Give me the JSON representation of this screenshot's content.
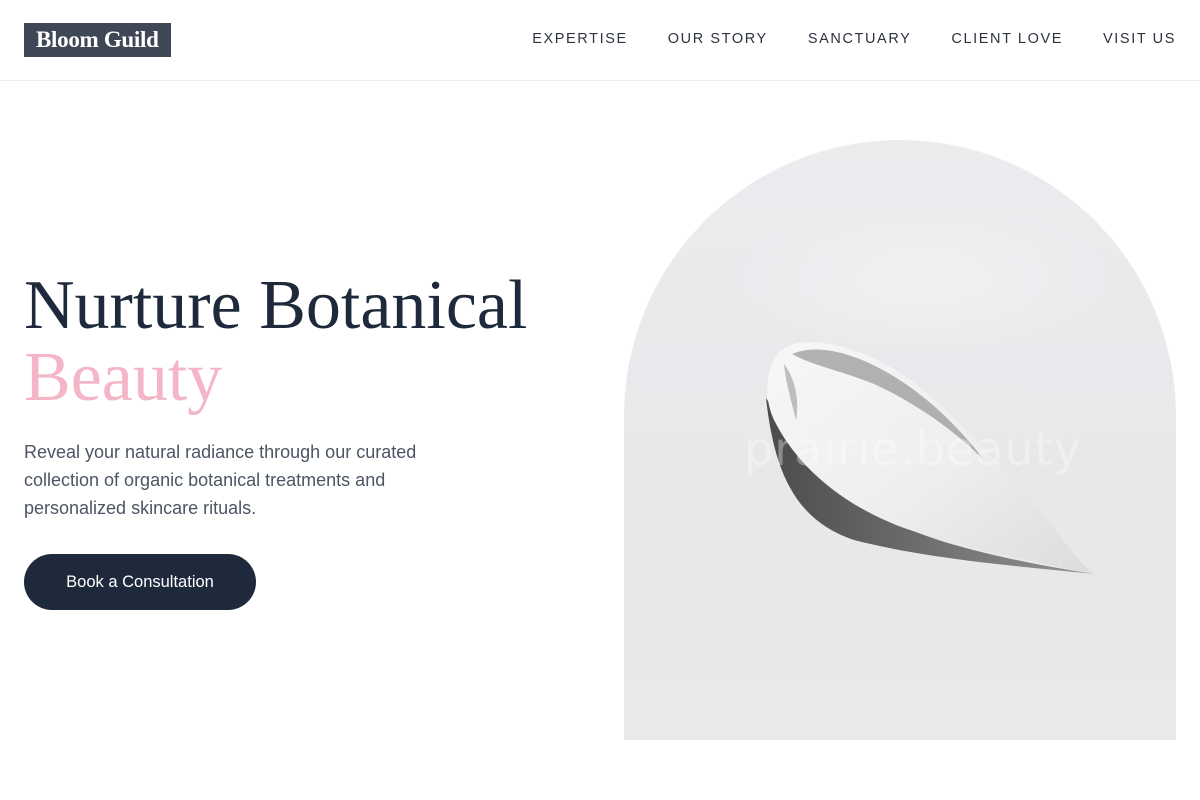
{
  "header": {
    "logo": "Bloom Guild",
    "nav": [
      "EXPERTISE",
      "OUR STORY",
      "SANCTUARY",
      "CLIENT LOVE",
      "VISIT US"
    ]
  },
  "hero": {
    "title_line1": "Nurture Botanical",
    "title_line2": "Beauty",
    "subtitle": "Reveal your natural radiance through our curated collection of organic botanical treatments and personalized skincare rituals.",
    "cta_label": "Book a Consultation",
    "image_watermark": "prairie.beauty"
  },
  "colors": {
    "primary": "#1e293b",
    "accent_pink": "#f4b6c6",
    "logo_bg": "#3f4656",
    "image_bg": "#ebeaed"
  },
  "icons": []
}
